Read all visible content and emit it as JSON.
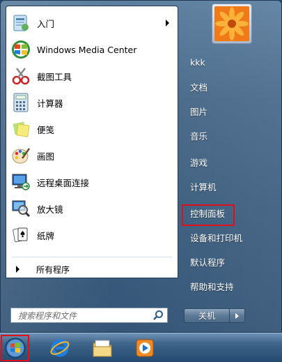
{
  "left_panel": {
    "items": [
      {
        "label": "入门",
        "icon": "getting-started-icon",
        "has_arrow": true
      },
      {
        "label": "Windows Media Center",
        "icon": "windows-media-center-icon"
      },
      {
        "label": "截图工具",
        "icon": "snipping-tool-icon"
      },
      {
        "label": "计算器",
        "icon": "calculator-icon"
      },
      {
        "label": "便笺",
        "icon": "sticky-notes-icon"
      },
      {
        "label": "画图",
        "icon": "paint-icon"
      },
      {
        "label": "远程桌面连接",
        "icon": "remote-desktop-icon"
      },
      {
        "label": "放大镜",
        "icon": "magnifier-icon"
      },
      {
        "label": "纸牌",
        "icon": "solitaire-icon"
      }
    ],
    "all_programs": "所有程序",
    "search_placeholder": "搜索程序和文件"
  },
  "right_panel": {
    "items": [
      {
        "label": "kkk"
      },
      {
        "label": "文档"
      },
      {
        "label": "图片"
      },
      {
        "label": "音乐"
      },
      {
        "label": "游戏"
      },
      {
        "label": "计算机"
      },
      {
        "label": "控制面板",
        "highlighted": true
      },
      {
        "label": "设备和打印机"
      },
      {
        "label": "默认程序"
      },
      {
        "label": "帮助和支持"
      }
    ],
    "shutdown_label": "关机"
  },
  "taskbar": {
    "items": [
      "start-orb-icon",
      "internet-explorer-icon",
      "windows-explorer-icon",
      "media-player-icon"
    ]
  },
  "colors": {
    "highlight_box": "#e0101a"
  }
}
